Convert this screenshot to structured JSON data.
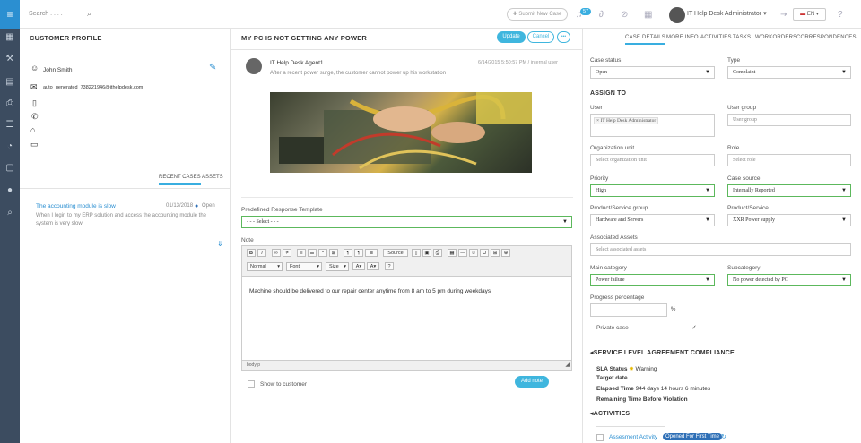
{
  "topbar": {
    "search_placeholder": "Search . . . .",
    "submit_new_case": "Submit New Case",
    "notification_count": "57",
    "user_name": "IT Help Desk Administrator",
    "language": "EN"
  },
  "profile": {
    "title": "CUSTOMER PROFILE",
    "name": "John Smith",
    "email": "auto_generated_738221946@ithelpdesk.com",
    "tabs": [
      "RECENT CASES",
      "ASSETS"
    ],
    "recent_case": {
      "title": "The accounting module is slow",
      "date": "01/13/2018",
      "status": "Open",
      "description": "When I login to my ERP solution and access the accounting module the system is very slow"
    }
  },
  "case": {
    "title": "MY PC IS NOT GETTING ANY POWER",
    "update_label": "Update",
    "cancel_label": "Cancel",
    "more_label": "•••",
    "agent": "IT Help Desk Agent1",
    "timestamp": "6/14/2015 5:50:57 PM / internal user",
    "message": "After a recent power surge, the customer cannot power up his workstation",
    "predefined_label": "Predefined Response Template",
    "predefined_value": "- - - Select - - -",
    "note_label": "Note",
    "toolbar": {
      "source": "Source",
      "format": "Normal",
      "font": "Font",
      "size": "Size"
    },
    "note_text": "Machine should be delivered to our repair center anytime from 8 am to 5 pm during weekdays",
    "status_path": "body  p",
    "show_to_customer": "Show to customer",
    "add_note": "Add note"
  },
  "details": {
    "tabs": [
      "CASE DETAILS",
      "MORE INFO",
      "ACTIVITIES",
      "TASKS",
      "WORKORDERS",
      "CORRESPONDENCES"
    ],
    "case_status_label": "Case status",
    "case_status": "Open",
    "type_label": "Type",
    "type": "Complaint",
    "assign_to": "ASSIGN TO",
    "user_label": "User",
    "user_chip": "× IT Help Desk Administrator",
    "user_group_label": "User group",
    "user_group_placeholder": "User group",
    "org_unit_label": "Organization unit",
    "org_unit_placeholder": "Select organization unit",
    "role_label": "Role",
    "role_placeholder": "Select role",
    "priority_label": "Priority",
    "priority": "High",
    "case_source_label": "Case source",
    "case_source": "Internally Reported",
    "psg_label": "Product/Service group",
    "psg": "Hardware and Servers",
    "ps_label": "Product/Service",
    "ps": "XXR Power supply",
    "assets_label": "Associated Assets",
    "assets_placeholder": "Select associated assets",
    "main_cat_label": "Main category",
    "main_cat": "Power failure",
    "sub_cat_label": "Subcategory",
    "sub_cat": "No power detected by PC",
    "progress_label": "Progress percentage",
    "progress_unit": "%",
    "private_label": "Private case",
    "sla_title": "SERVICE LEVEL AGREEMENT COMPLIANCE",
    "sla_status_label": "SLA Status",
    "sla_status": "Warning",
    "target_label": "Target date",
    "elapsed_label": "Elapsed Time",
    "elapsed": "944 days 14 hours 6 minutes",
    "remaining_label": "Remaining Time Before Violation",
    "activities_title": "ACTIVITIES",
    "activity_name": "Assesment Activity",
    "activity_status": "Opened For First Time"
  },
  "colors": {
    "accent": "#39aee0",
    "sidebar": "#3c4c60",
    "valid": "#5cb85c"
  }
}
